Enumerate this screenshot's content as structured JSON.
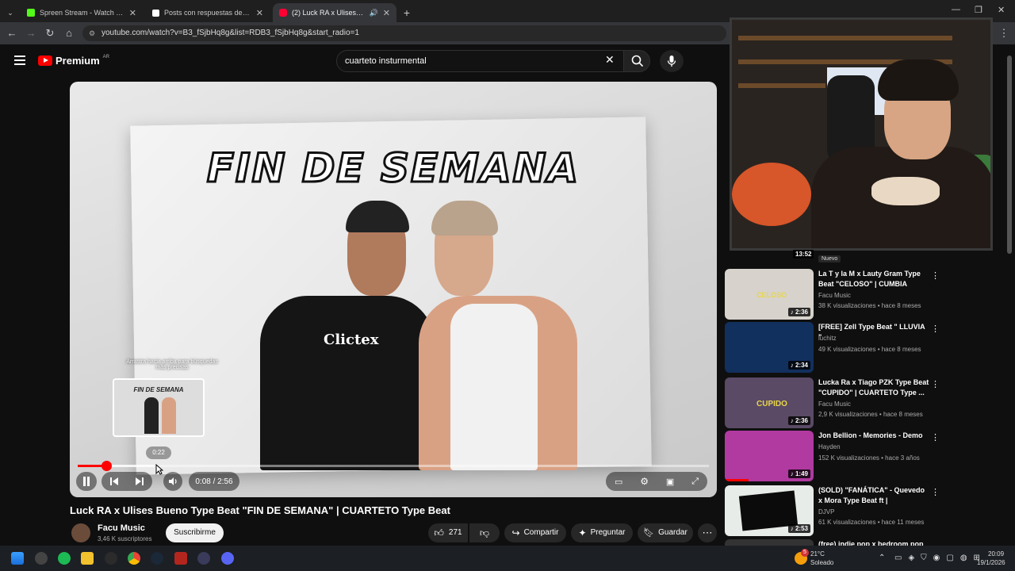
{
  "browser": {
    "tabs": [
      {
        "label": "Spreen Stream - Watch Live on",
        "favicon_color": "#53fc18",
        "active": false
      },
      {
        "label": "Posts con respuestas de spreen",
        "favicon_color": "#ffffff",
        "active": false
      },
      {
        "label": "(2) Luck RA x Ulises Bueno",
        "favicon_color": "#ff0033",
        "active": true
      }
    ],
    "new_tab": "+",
    "url": "youtube.com/watch?v=B3_fSjbHq8g&list=RDB3_fSjbHq8g&start_radio=1"
  },
  "youtube": {
    "logo_text": "Premium",
    "region": "AR",
    "search_value": "cuarteto insturmental",
    "accent_color": "#ff0000"
  },
  "player": {
    "video_title_art": "FIN DE SEMANA",
    "shirt_logo": "Clictex",
    "hint": "Arrastra hacia arriba para búsquedas más precisas",
    "preview_title": "FIN DE SEMANA",
    "hover_time": "0:22",
    "time_display": "0:08 / 2:56",
    "progress": 0.045,
    "buffered": 0.12
  },
  "video": {
    "title": "Luck RA x Ulises Bueno Type Beat \"FIN DE SEMANA\" | CUARTETO Type Beat",
    "channel": "Facu Music",
    "subscribers": "3,46 K suscriptores",
    "subscribe_label": "Suscribirme",
    "likes": "271",
    "share_label": "Compartir",
    "ask_label": "Preguntar",
    "save_label": "Guardar"
  },
  "sidebar": {
    "top_duration": "13:52",
    "top_badge": "Nuevo",
    "items": [
      {
        "title": "La T y la M x Lauty Gram Type Beat \"CELOSO\" | CUMBIA Type...",
        "channel": "Facu Music",
        "meta": "38 K visualizaciones • hace 8 meses",
        "duration": "2:36",
        "thumb_color": "#d7d2cc",
        "thumb_text": "CELOSO"
      },
      {
        "title": "[FREE] Zell Type Beat \" LLUVIA \"",
        "channel": "luchitz",
        "meta": "49 K visualizaciones • hace 8 meses",
        "duration": "2:34",
        "thumb_color": "#12305e",
        "thumb_text": ""
      },
      {
        "title": "Lucka Ra x Tiago PZK Type Beat \"CUPIDO\" | CUARTETO Type ...",
        "channel": "Facu Music",
        "meta": "2,9 K visualizaciones • hace 8 meses",
        "duration": "2:36",
        "thumb_color": "#5a4a66",
        "thumb_text": "CUPIDO"
      },
      {
        "title": "Jon Bellion - Memories - Demo",
        "channel": "Hayden",
        "meta": "152 K visualizaciones • hace 3 años",
        "duration": "1:49",
        "thumb_color": "#b03aa0",
        "thumb_text": ""
      },
      {
        "title": "(SOLD) \"FANÁTICA\" - Quevedo x Mora Type Beat ft | Instrument...",
        "channel": "DJVP",
        "meta": "61 K visualizaciones • hace 11 meses",
        "duration": "2:53",
        "thumb_color": "#e8ece8",
        "thumb_text": ""
      },
      {
        "title": "(free) indie pop x bedroom pop",
        "channel": "",
        "meta": "",
        "duration": "",
        "thumb_color": "#333333",
        "thumb_text": ""
      }
    ]
  },
  "taskbar": {
    "weather_temp": "21°C",
    "weather_desc": "Soleado",
    "weather_badge": "5",
    "time": "20:09",
    "date": "19/1/2026"
  }
}
